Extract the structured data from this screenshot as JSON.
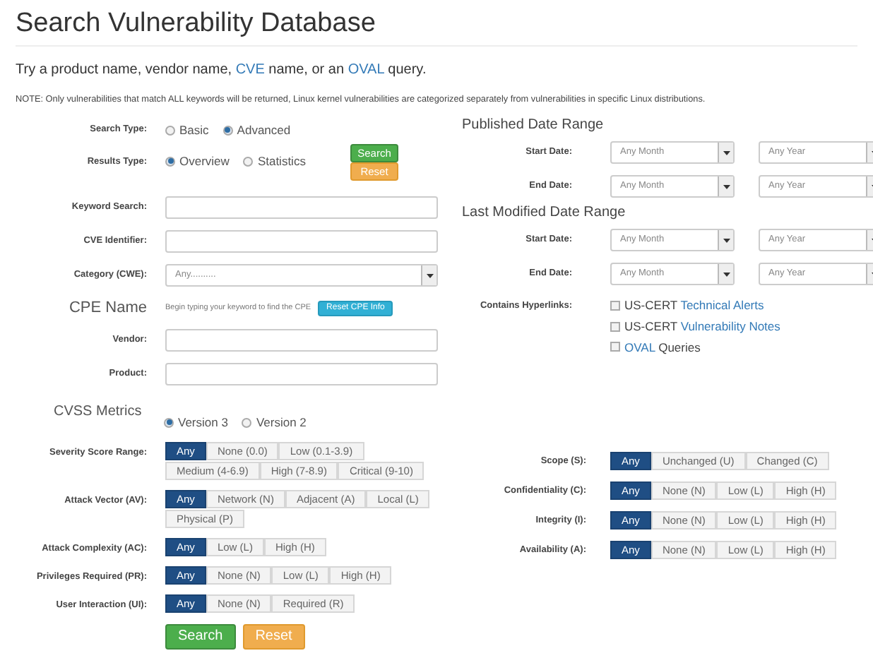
{
  "title": "Search Vulnerability Database",
  "intro": [
    {
      "text": "Try a product name, vendor name, ",
      "link": false
    },
    {
      "text": "CVE",
      "link": true
    },
    {
      "text": " name, or an ",
      "link": false
    },
    {
      "text": "OVAL",
      "link": true
    },
    {
      "text": " query.",
      "link": false
    }
  ],
  "note": "NOTE: Only vulnerabilities that match ALL keywords will be returned, Linux kernel vulnerabilities are categorized separately from vulnerabilities in specific Linux distributions.",
  "search_type": {
    "label": "Search Type:",
    "options": [
      {
        "label": "Basic",
        "selected": false
      },
      {
        "label": "Advanced",
        "selected": true
      }
    ]
  },
  "results_type": {
    "label": "Results Type:",
    "options": [
      {
        "label": "Overview",
        "selected": true
      },
      {
        "label": "Statistics",
        "selected": false
      }
    ]
  },
  "top_buttons": [
    {
      "label": "Search",
      "kind": "primary"
    },
    {
      "label": "Reset",
      "kind": "warning"
    }
  ],
  "fields": [
    {
      "label": "Keyword Search:",
      "kind": "text"
    },
    {
      "label": "CVE Identifier:",
      "kind": "text"
    },
    {
      "label": "Category (CWE):",
      "kind": "select",
      "value": "Any.........."
    }
  ],
  "cpe": {
    "heading": "CPE Name",
    "hint": "Begin typing your keyword to find the CPE",
    "button": "Reset CPE Info",
    "fields": [
      {
        "label": "Vendor:"
      },
      {
        "label": "Product:"
      }
    ]
  },
  "date_ranges": [
    {
      "heading": "Published Date Range",
      "rows": [
        {
          "label": "Start Date:",
          "month": "Any Month",
          "year": "Any Year"
        },
        {
          "label": "End Date:",
          "month": "Any Month",
          "year": "Any Year"
        }
      ]
    },
    {
      "heading": "Last Modified Date Range",
      "rows": [
        {
          "label": "Start Date:",
          "month": "Any Month",
          "year": "Any Year"
        },
        {
          "label": "End Date:",
          "month": "Any Month",
          "year": "Any Year"
        }
      ]
    }
  ],
  "hyperlinks": {
    "label": "Contains Hyperlinks:",
    "items": [
      {
        "checked": false,
        "parts": [
          {
            "text": "US-CERT ",
            "link": false
          },
          {
            "text": "Technical Alerts",
            "link": true
          }
        ]
      },
      {
        "checked": false,
        "parts": [
          {
            "text": "US-CERT ",
            "link": false
          },
          {
            "text": "Vulnerability Notes",
            "link": true
          }
        ]
      },
      {
        "checked": false,
        "parts": [
          {
            "text": "OVAL",
            "link": true
          },
          {
            "text": " Queries",
            "link": false
          }
        ]
      }
    ]
  },
  "cvss": {
    "heading": "CVSS Metrics",
    "versions": [
      {
        "label": "Version 3",
        "selected": true
      },
      {
        "label": "Version 2",
        "selected": false
      }
    ],
    "metrics_left": [
      {
        "label": "Severity Score Range:",
        "options": [
          {
            "label": "Any",
            "selected": true
          },
          {
            "label": "None (0.0)",
            "selected": false
          },
          {
            "label": "Low (0.1-3.9)",
            "selected": false
          },
          {
            "label": "Medium (4-6.9)",
            "selected": false
          },
          {
            "label": "High (7-8.9)",
            "selected": false
          },
          {
            "label": "Critical (9-10)",
            "selected": false
          }
        ]
      },
      {
        "label": "Attack Vector (AV):",
        "options": [
          {
            "label": "Any",
            "selected": true
          },
          {
            "label": "Network (N)",
            "selected": false
          },
          {
            "label": "Adjacent (A)",
            "selected": false
          },
          {
            "label": "Local (L)",
            "selected": false
          },
          {
            "label": "Physical (P)",
            "selected": false
          }
        ]
      },
      {
        "label": "Attack Complexity (AC):",
        "options": [
          {
            "label": "Any",
            "selected": true
          },
          {
            "label": "Low (L)",
            "selected": false
          },
          {
            "label": "High (H)",
            "selected": false
          }
        ]
      },
      {
        "label": "Privileges Required (PR):",
        "options": [
          {
            "label": "Any",
            "selected": true
          },
          {
            "label": "None (N)",
            "selected": false
          },
          {
            "label": "Low (L)",
            "selected": false
          },
          {
            "label": "High (H)",
            "selected": false
          }
        ]
      },
      {
        "label": "User Interaction (UI):",
        "options": [
          {
            "label": "Any",
            "selected": true
          },
          {
            "label": "None (N)",
            "selected": false
          },
          {
            "label": "Required (R)",
            "selected": false
          }
        ]
      }
    ],
    "metrics_right": [
      {
        "label": "Scope (S):",
        "options": [
          {
            "label": "Any",
            "selected": true
          },
          {
            "label": "Unchanged (U)",
            "selected": false
          },
          {
            "label": "Changed (C)",
            "selected": false
          }
        ]
      },
      {
        "label": "Confidentiality (C):",
        "options": [
          {
            "label": "Any",
            "selected": true
          },
          {
            "label": "None (N)",
            "selected": false
          },
          {
            "label": "Low (L)",
            "selected": false
          },
          {
            "label": "High (H)",
            "selected": false
          }
        ]
      },
      {
        "label": "Integrity (I):",
        "options": [
          {
            "label": "Any",
            "selected": true
          },
          {
            "label": "None (N)",
            "selected": false
          },
          {
            "label": "Low (L)",
            "selected": false
          },
          {
            "label": "High (H)",
            "selected": false
          }
        ]
      },
      {
        "label": "Availability (A):",
        "options": [
          {
            "label": "Any",
            "selected": true
          },
          {
            "label": "None (N)",
            "selected": false
          },
          {
            "label": "Low (L)",
            "selected": false
          },
          {
            "label": "High (H)",
            "selected": false
          }
        ]
      }
    ]
  },
  "bottom_buttons": [
    {
      "label": "Search",
      "kind": "primary"
    },
    {
      "label": "Reset",
      "kind": "warning"
    }
  ]
}
